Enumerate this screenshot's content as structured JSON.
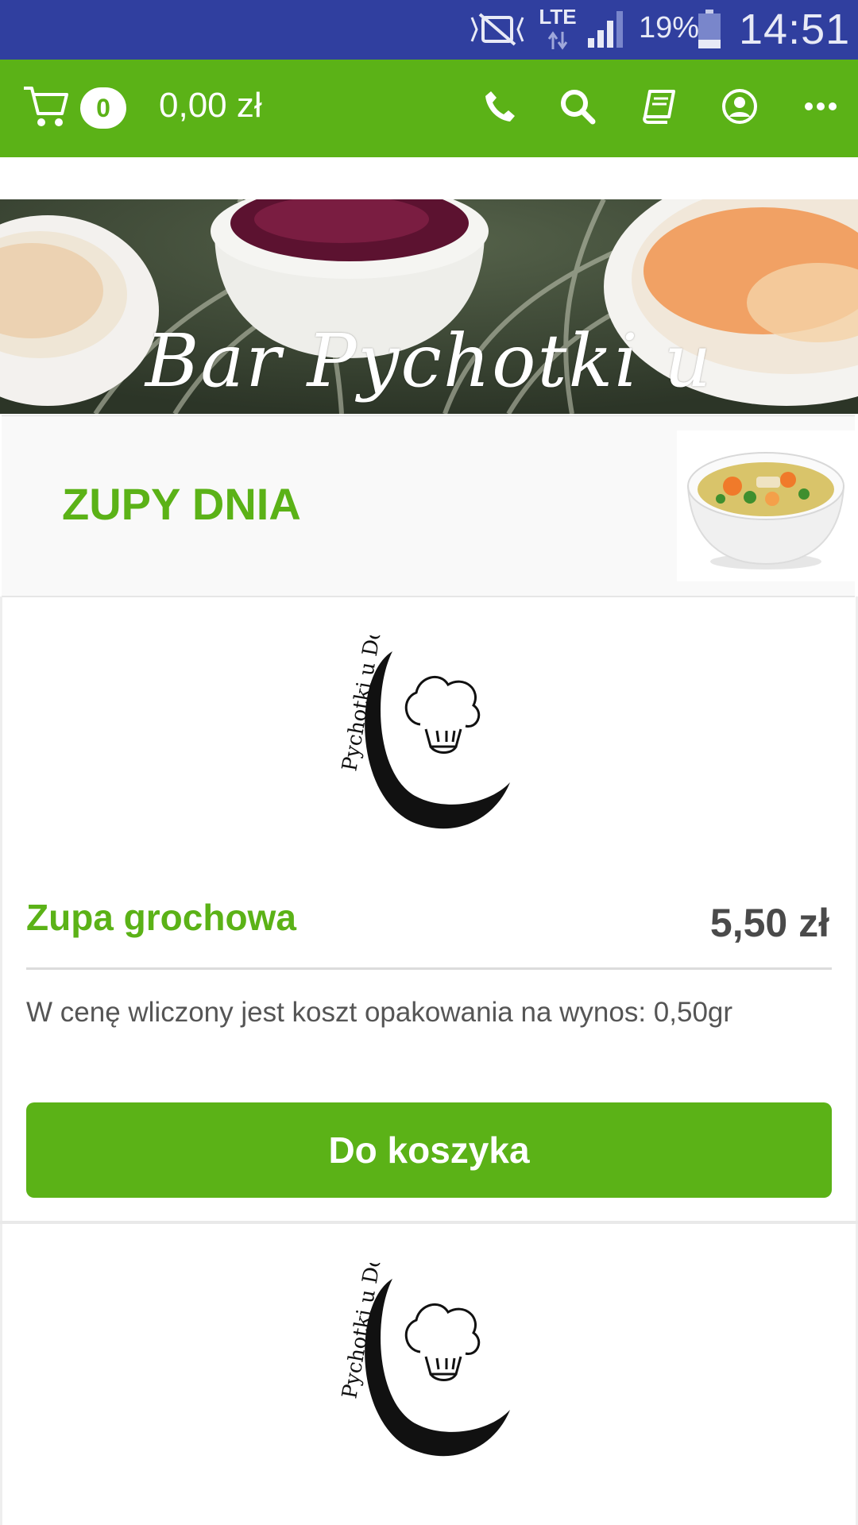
{
  "status_bar": {
    "network": "LTE",
    "battery": "19%",
    "time": "14:51",
    "icons": [
      "mute-icon",
      "lte-icon",
      "signal-icon",
      "battery-icon"
    ]
  },
  "header": {
    "cart_count": "0",
    "cart_total": "0,00 zł",
    "icons": [
      "cart-icon",
      "phone-icon",
      "search-icon",
      "book-icon",
      "user-icon",
      "more-icon"
    ]
  },
  "banner": {
    "title": "Bar Pychotki u Dorotki"
  },
  "category": {
    "title": "ZUPY DNIA"
  },
  "logo": {
    "text": "Pychotki u Dorotki"
  },
  "product": {
    "name": "Zupa grochowa",
    "price": "5,50 zł",
    "description": "W cenę wliczony jest koszt opakowania na wynos: 0,50gr",
    "button": "Do koszyka"
  },
  "colors": {
    "status_bar": "#303f9f",
    "accent": "#5bb217",
    "price_text": "#4a4a4a"
  }
}
